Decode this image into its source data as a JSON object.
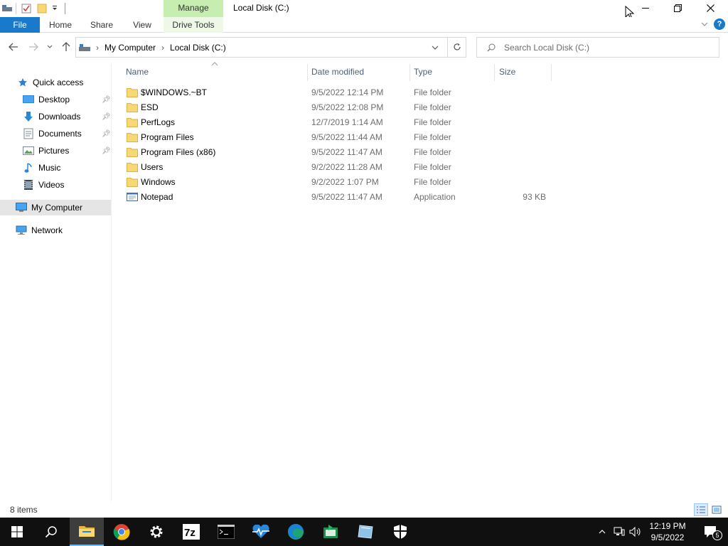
{
  "window": {
    "title": "Local Disk (C:)",
    "manage_tab": "Manage"
  },
  "ribbon": {
    "tabs": [
      "File",
      "Home",
      "Share",
      "View",
      "Drive Tools"
    ]
  },
  "address": {
    "segments": [
      "My Computer",
      "Local Disk (C:)"
    ]
  },
  "search": {
    "placeholder": "Search Local Disk (C:)"
  },
  "sidebar": {
    "quick_access": "Quick access",
    "items": [
      {
        "label": "Desktop",
        "icon": "desktop-icon",
        "pinned": true
      },
      {
        "label": "Downloads",
        "icon": "download-icon",
        "pinned": true
      },
      {
        "label": "Documents",
        "icon": "documents-icon",
        "pinned": true
      },
      {
        "label": "Pictures",
        "icon": "pictures-icon",
        "pinned": true
      },
      {
        "label": "Music",
        "icon": "music-icon",
        "pinned": false
      },
      {
        "label": "Videos",
        "icon": "videos-icon",
        "pinned": false
      }
    ],
    "my_computer": "My Computer",
    "network": "Network"
  },
  "columns": {
    "name": "Name",
    "date": "Date modified",
    "type": "Type",
    "size": "Size"
  },
  "files": [
    {
      "name": "$WINDOWS.~BT",
      "date": "9/5/2022 12:14 PM",
      "type": "File folder",
      "size": "",
      "icon": "folder-icon"
    },
    {
      "name": "ESD",
      "date": "9/5/2022 12:08 PM",
      "type": "File folder",
      "size": "",
      "icon": "folder-icon"
    },
    {
      "name": "PerfLogs",
      "date": "12/7/2019 1:14 AM",
      "type": "File folder",
      "size": "",
      "icon": "folder-icon"
    },
    {
      "name": "Program Files",
      "date": "9/5/2022 11:44 AM",
      "type": "File folder",
      "size": "",
      "icon": "folder-icon"
    },
    {
      "name": "Program Files (x86)",
      "date": "9/5/2022 11:47 AM",
      "type": "File folder",
      "size": "",
      "icon": "folder-icon"
    },
    {
      "name": "Users",
      "date": "9/2/2022 11:28 AM",
      "type": "File folder",
      "size": "",
      "icon": "folder-icon"
    },
    {
      "name": "Windows",
      "date": "9/2/2022 1:07 PM",
      "type": "File folder",
      "size": "",
      "icon": "folder-icon"
    },
    {
      "name": "Notepad",
      "date": "9/5/2022 11:47 AM",
      "type": "Application",
      "size": "93 KB",
      "icon": "application-icon"
    }
  ],
  "status": {
    "item_count": "8 items"
  },
  "taskbar": {
    "time": "12:19 PM",
    "date": "9/5/2022",
    "notification_count": "5",
    "apps": [
      "start-icon",
      "search-icon",
      "file-explorer-icon",
      "chrome-icon",
      "settings-icon",
      "7zip-icon",
      "terminal-icon",
      "health-monitor-icon",
      "edge-icon",
      "spreadsheet-icon",
      "tablet-icon",
      "security-icon"
    ]
  },
  "colors": {
    "file_tab": "#1979ca",
    "manage_tab": "#c7edb0",
    "folder": "#f8d775",
    "taskbar": "#101010",
    "selected_nav": "#e5e5e5"
  }
}
